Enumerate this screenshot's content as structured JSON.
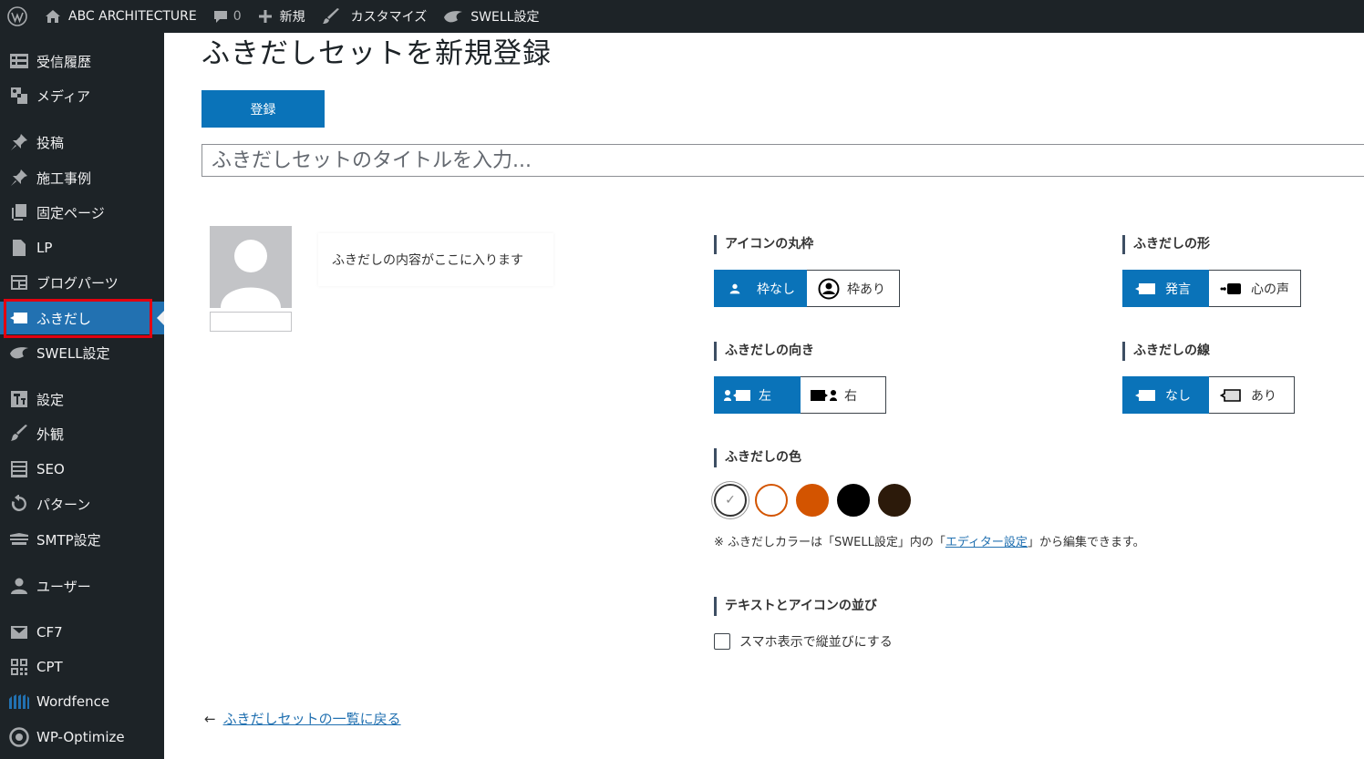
{
  "adminbar": {
    "site_name": "ABC ARCHITECTURE",
    "comments_count": "0",
    "new_label": "新規",
    "customize_label": "カスタマイズ",
    "swell_label": "SWELL設定"
  },
  "sidebar": {
    "items": [
      {
        "label": "受信履歴",
        "icon": "list-icon"
      },
      {
        "label": "メディア",
        "icon": "media-icon"
      },
      {
        "label": "投稿",
        "icon": "pin-icon"
      },
      {
        "label": "施工事例",
        "icon": "pin-icon"
      },
      {
        "label": "固定ページ",
        "icon": "pages-icon"
      },
      {
        "label": "LP",
        "icon": "document-icon"
      },
      {
        "label": "ブログパーツ",
        "icon": "grid-icon"
      },
      {
        "label": "ふきだし",
        "icon": "speech-bubble-icon"
      },
      {
        "label": "SWELL設定",
        "icon": "swell-icon"
      },
      {
        "label": "設定",
        "icon": "settings-icon"
      },
      {
        "label": "外観",
        "icon": "brush-icon"
      },
      {
        "label": "SEO",
        "icon": "list-icon"
      },
      {
        "label": "パターン",
        "icon": "rotate-icon"
      },
      {
        "label": "SMTP設定",
        "icon": "mail-stack-icon"
      },
      {
        "label": "ユーザー",
        "icon": "user-icon"
      },
      {
        "label": "CF7",
        "icon": "envelope-icon"
      },
      {
        "label": "CPT",
        "icon": "qr-icon"
      },
      {
        "label": "Wordfence",
        "icon": "wordfence-icon"
      },
      {
        "label": "WP-Optimize",
        "icon": "optimize-icon"
      }
    ],
    "current": "ふきだし"
  },
  "main": {
    "page_title": "ふきだしセットを新規登録",
    "register_button": "登録",
    "title_placeholder": "ふきだしセットのタイトルを入力...",
    "bubble_text": "ふきだしの内容がここに入ります",
    "settings": {
      "icon_border": {
        "label": "アイコンの丸枠",
        "options": [
          "枠なし",
          "枠あり"
        ],
        "selected": "枠なし"
      },
      "shape": {
        "label": "ふきだしの形",
        "options": [
          "発言",
          "心の声"
        ],
        "selected": "発言"
      },
      "direction": {
        "label": "ふきだしの向き",
        "options": [
          "左",
          "右"
        ],
        "selected": "左"
      },
      "line": {
        "label": "ふきだしの線",
        "options": [
          "なし",
          "あり"
        ],
        "selected": "なし"
      },
      "color": {
        "label": "ふきだしの色",
        "swatches": [
          "#ffffff",
          "#ffffff",
          "#d35400",
          "#000000",
          "#2c1a0a"
        ],
        "swatch_borders": [
          "#333333",
          "#d35400",
          "#d35400",
          "#000000",
          "#2c1a0a"
        ],
        "selected_index": 0
      },
      "color_note": {
        "before": "※ ふきだしカラーは「SWELL設定」内の「",
        "link": "エディター設定",
        "after": "」から編集できます。"
      },
      "layout": {
        "label": "テキストとアイコンの並び",
        "checkbox_label": "スマホ表示で縦並びにする"
      }
    },
    "back_link": "ふきだしセットの一覧に戻る",
    "accent_color": "#0a73b9"
  }
}
